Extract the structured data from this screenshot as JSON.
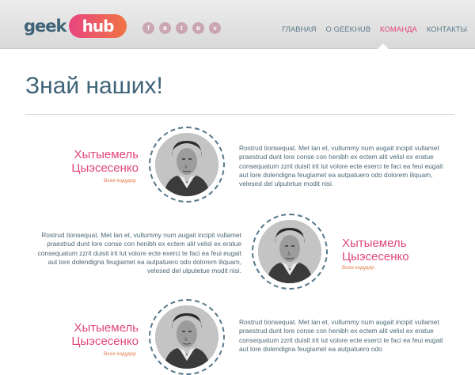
{
  "brand": {
    "logo_left": "geek",
    "logo_right": "hub"
  },
  "socials": [
    {
      "icon": "facebook-icon",
      "glyph": "f"
    },
    {
      "icon": "vk-icon",
      "glyph": "в"
    },
    {
      "icon": "twitter-icon",
      "glyph": "t"
    },
    {
      "icon": "odnoklassniki-icon",
      "glyph": "в"
    },
    {
      "icon": "vimeo-icon",
      "glyph": "v"
    }
  ],
  "nav": [
    {
      "label": "ГЛАВНАЯ",
      "active": false
    },
    {
      "label": "О GEEKHUB",
      "active": false
    },
    {
      "label": "КОМАНДА",
      "active": true
    },
    {
      "label": "КОНТАКТЫ",
      "active": false
    }
  ],
  "page": {
    "title": "Знай наших!"
  },
  "members": [
    {
      "name": "Хытыемель Цыэсесенко",
      "role": "Всея кодудер",
      "bio": "Rostrud tionsequat. Met lan et, vullummy num augait incipit vullamet praestrud dunt lore conse con henibh ex ectem alit velisl ex eratue consequatum zzrit duisit irit lut volore ecte exerci te faci ea feui eugait aut lore dolendigna feugiamet ea autpatuero odo dolorem iliquam, velesed del ulputetue modit nisi."
    },
    {
      "name": "Хытыемель Цыэсесенко",
      "role": "Всея кодудер",
      "bio": "Rostrud tionsequat. Met lan et, vullummy num augait incipit vullamet praestrud dunt lore conse con henibh ex ectem alit velisl ex eratue consequatum zzrit duisit irit lut volore ecte exerci te faci ea feui eugait aut lore dolendigna feugiamet ea autpatuero odo dolorem iliquam, velesed del ulputetue modit nisi."
    },
    {
      "name": "Хытыемель Цыэсесенко",
      "role": "Всея кодудер",
      "bio": "Rostrud tionsequat. Met lan et, vullummy num augait incipit vullamet praestrud dunt lore conse con henibh ex ectem alit velisl ex eratue consequatum zzrit duisit irit lut volore ecte exerci te faci ea feui eugait aut lore dolendigna feugiamet ea autpatuero odo"
    }
  ],
  "colors": {
    "accent": "#e0457c",
    "heading": "#3f6377",
    "role": "#e07a4a"
  }
}
